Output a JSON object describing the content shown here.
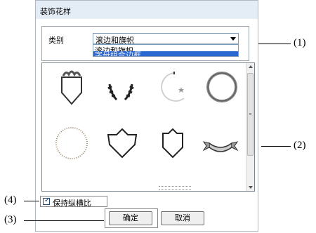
{
  "dialog": {
    "title": "装饰花样"
  },
  "category": {
    "label": "类别",
    "selected": "滚边和旗帜",
    "options": [
      "滚边和旗帜",
      "字母组合边框"
    ]
  },
  "gallery": {
    "items": [
      "shield-crest-icon",
      "laurel-wreath-icon",
      "star-crescent-icon",
      "ring-icon",
      "dotted-circle-icon",
      "star-shield-icon",
      "pentagon-shield-icon",
      "ribbon-banner-icon"
    ]
  },
  "options": {
    "keep_aspect_label": "保持纵横比",
    "keep_aspect_checked": true,
    "check_mark": "✓"
  },
  "buttons": {
    "ok": "确定",
    "cancel": "取消"
  },
  "callouts": {
    "c1": "(1)",
    "c2": "(2)",
    "c3": "(3)",
    "c4": "(4)"
  }
}
